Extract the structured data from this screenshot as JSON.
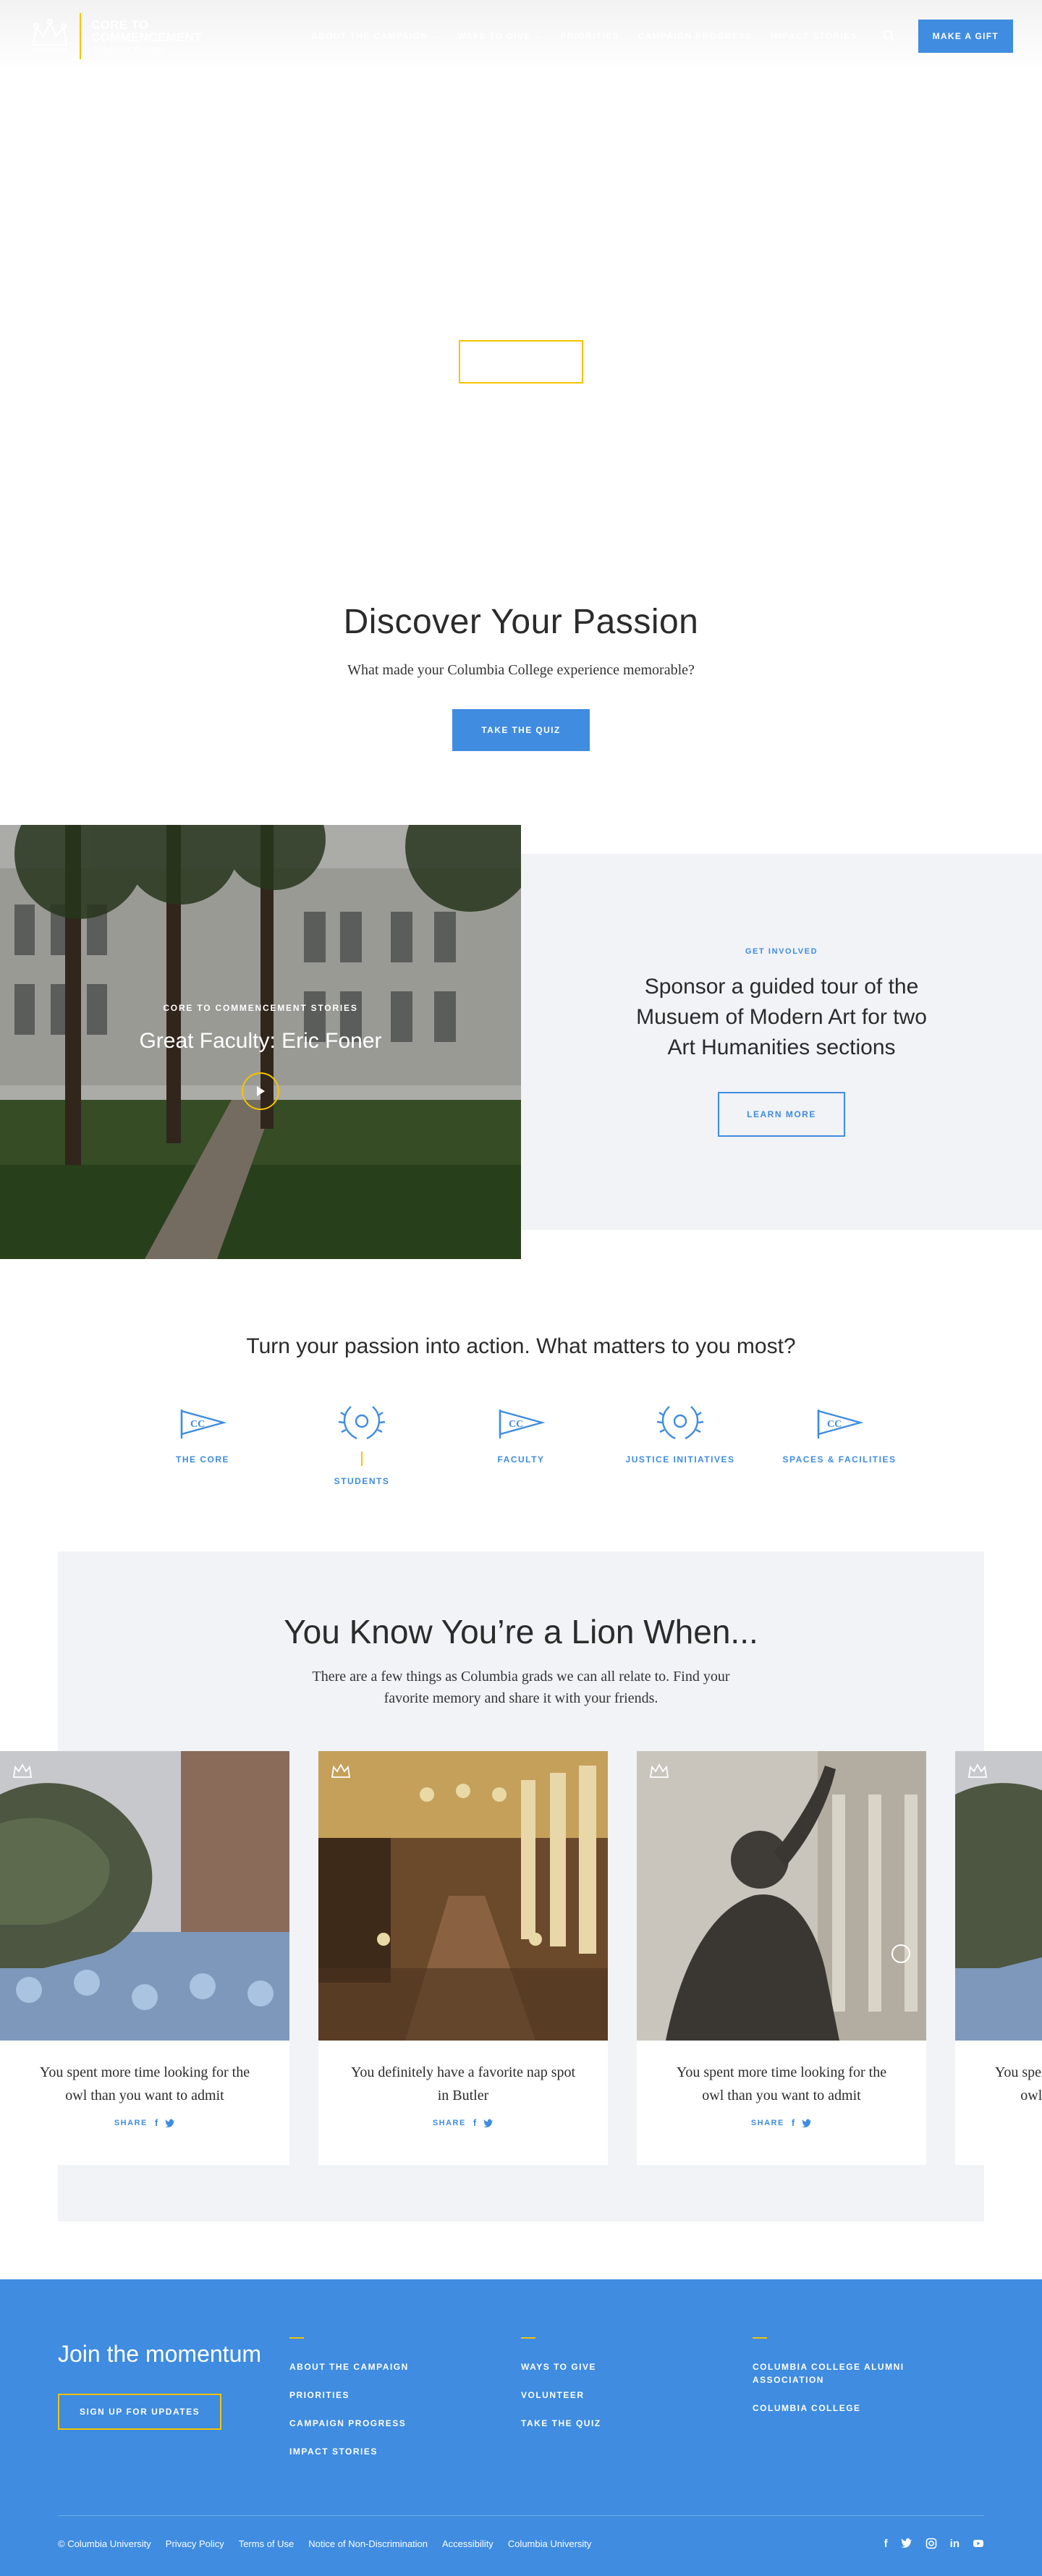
{
  "header": {
    "logo_line1": "Core to",
    "logo_line2": "Commencement",
    "logo_sub": "Columbia College",
    "nav": [
      {
        "label": "About the Campaign"
      },
      {
        "label": "Ways to Give"
      },
      {
        "label": "Priorities"
      },
      {
        "label": "Campaign Progress"
      },
      {
        "label": "Impact Stories"
      }
    ],
    "gift_label": "Make a Gift"
  },
  "passion": {
    "title": "Discover Your Passion",
    "subtitle": "What made your Columbia College experience memorable?",
    "button": "Take the Quiz"
  },
  "feature": {
    "eyebrow": "Core to Commencement Stories",
    "title": "Great Faculty: Eric Foner",
    "right_eyebrow": "Get Involved",
    "right_title": "Sponsor a guided tour of the Musuem of Modern Art for two Art Humanities sections",
    "right_button": "Learn More"
  },
  "action": {
    "title": "Turn your passion into action. What matters to you most?",
    "categories": [
      {
        "label": "The Core",
        "icon": "pennant-icon"
      },
      {
        "label": "Students",
        "icon": "laurel-icon"
      },
      {
        "label": "Faculty",
        "icon": "pennant-icon"
      },
      {
        "label": "Justice Initiatives",
        "icon": "laurel-icon"
      },
      {
        "label": "Spaces & Facilities",
        "icon": "pennant-icon"
      }
    ]
  },
  "lion": {
    "title": "You Know You’re a Lion When...",
    "subtitle": "There are a few things as Columbia grads we can all relate to. Find your favorite memory and share it with your friends.",
    "cards": [
      {
        "text": "You spent more time looking for the owl than you want to admit"
      },
      {
        "text": "You definitely have a favorite nap spot in Butler"
      },
      {
        "text": "You spent more time looking for the owl than you want to admit"
      },
      {
        "text": "You spent more time looking for the owl than you want to admit"
      }
    ],
    "share_label": "SHARE"
  },
  "footer": {
    "join_title": "Join the momentum",
    "signup": "Sign up for updates",
    "col1": [
      "About the Campaign",
      "Priorities",
      "Campaign Progress",
      "Impact Stories"
    ],
    "col2": [
      "Ways to Give",
      "Volunteer",
      "Take the Quiz"
    ],
    "col3": [
      "Columbia College Alumni Association",
      "Columbia College"
    ],
    "bottom": [
      "© Columbia University",
      "Privacy Policy",
      "Terms of Use",
      "Notice of Non-Discrimination",
      "Accessibility",
      "Columbia University"
    ],
    "social": [
      "facebook-icon",
      "twitter-icon",
      "instagram-icon",
      "linkedin-icon",
      "youtube-icon"
    ]
  },
  "colors": {
    "accent": "#3f8ce0",
    "gold": "#f4c400",
    "panel": "#f1f3f6"
  }
}
